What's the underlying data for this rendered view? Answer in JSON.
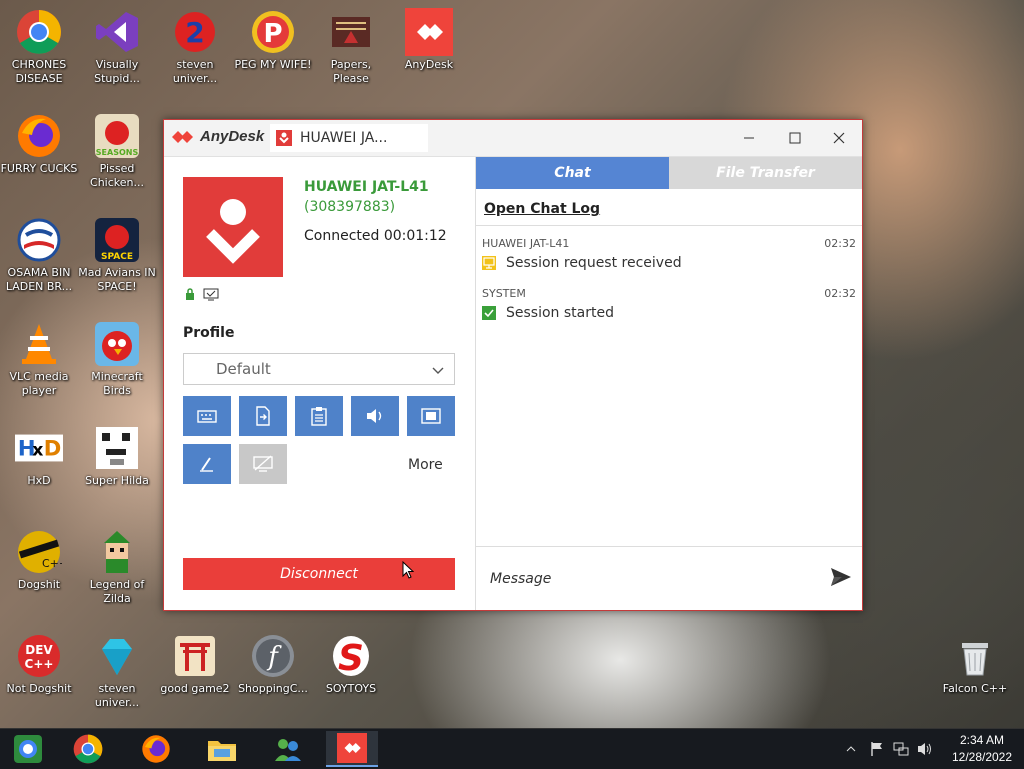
{
  "desktop_icons": [
    {
      "label": "CHRONES DISEASE",
      "icon": "chrome-icon"
    },
    {
      "label": "Visually Stupid...",
      "icon": "visual-studio-icon"
    },
    {
      "label": "steven univer...",
      "icon": "steven-universe-icon"
    },
    {
      "label": "PEG MY WIFE!",
      "icon": "peggle-icon"
    },
    {
      "label": "Papers, Please",
      "icon": "papers-please-icon"
    },
    {
      "label": "AnyDesk",
      "icon": "anydesk-icon"
    },
    {
      "label": "FURRY CUCKS",
      "icon": "firefox-icon"
    },
    {
      "label": "Pissed Chicken...",
      "icon": "angry-birds-seasons-icon"
    },
    {
      "label": "OSAMA BIN LADEN BR...",
      "icon": "obama-logo-icon"
    },
    {
      "label": "Mad Avians IN SPACE!",
      "icon": "angry-birds-space-icon"
    },
    {
      "label": "VLC media player",
      "icon": "vlc-icon"
    },
    {
      "label": "Minecraft Birds",
      "icon": "angry-bird-icon"
    },
    {
      "label": "HxD",
      "icon": "hxd-icon"
    },
    {
      "label": "Super Hilda",
      "icon": "super-hilda-icon"
    },
    {
      "label": "Dogshit",
      "icon": "codeblocks-icon"
    },
    {
      "label": "Legend of Zilda",
      "icon": "zelda-icon"
    },
    {
      "label": "Not Dogshit",
      "icon": "devcpp-icon"
    },
    {
      "label": "steven univer...",
      "icon": "diamond-icon"
    },
    {
      "label": "good game2",
      "icon": "torii-icon"
    },
    {
      "label": "ShoppingC...",
      "icon": "flash-icon"
    },
    {
      "label": "SOYTOYS",
      "icon": "s-logo-icon"
    },
    {
      "label": "Falcon C++",
      "icon": "recycle-bin-icon"
    }
  ],
  "window": {
    "app_name": "AnyDesk",
    "tab_title": "HUAWEI JA...",
    "device_name": "HUAWEI JAT-L41",
    "device_id": "(308397883)",
    "connection_status": "Connected 00:01:12",
    "profile_label": "Profile",
    "profile_value": "Default",
    "more_label": "More",
    "disconnect_label": "Disconnect",
    "tabs": {
      "chat": "Chat",
      "file_transfer": "File Transfer"
    },
    "open_chat_log": "Open Chat Log",
    "messages": [
      {
        "sender": "HUAWEI JAT-L41",
        "time": "02:32",
        "text": "Session request received"
      },
      {
        "sender": "SYSTEM",
        "time": "02:32",
        "text": "Session started"
      }
    ],
    "message_placeholder": "Message"
  },
  "taskbar": {
    "time": "2:34 AM",
    "date": "12/28/2022"
  },
  "colors": {
    "accent_red": "#ea3e3a",
    "tab_blue": "#5585d3",
    "tool_blue": "#4f82c9",
    "device_green": "#3a9a3a"
  }
}
